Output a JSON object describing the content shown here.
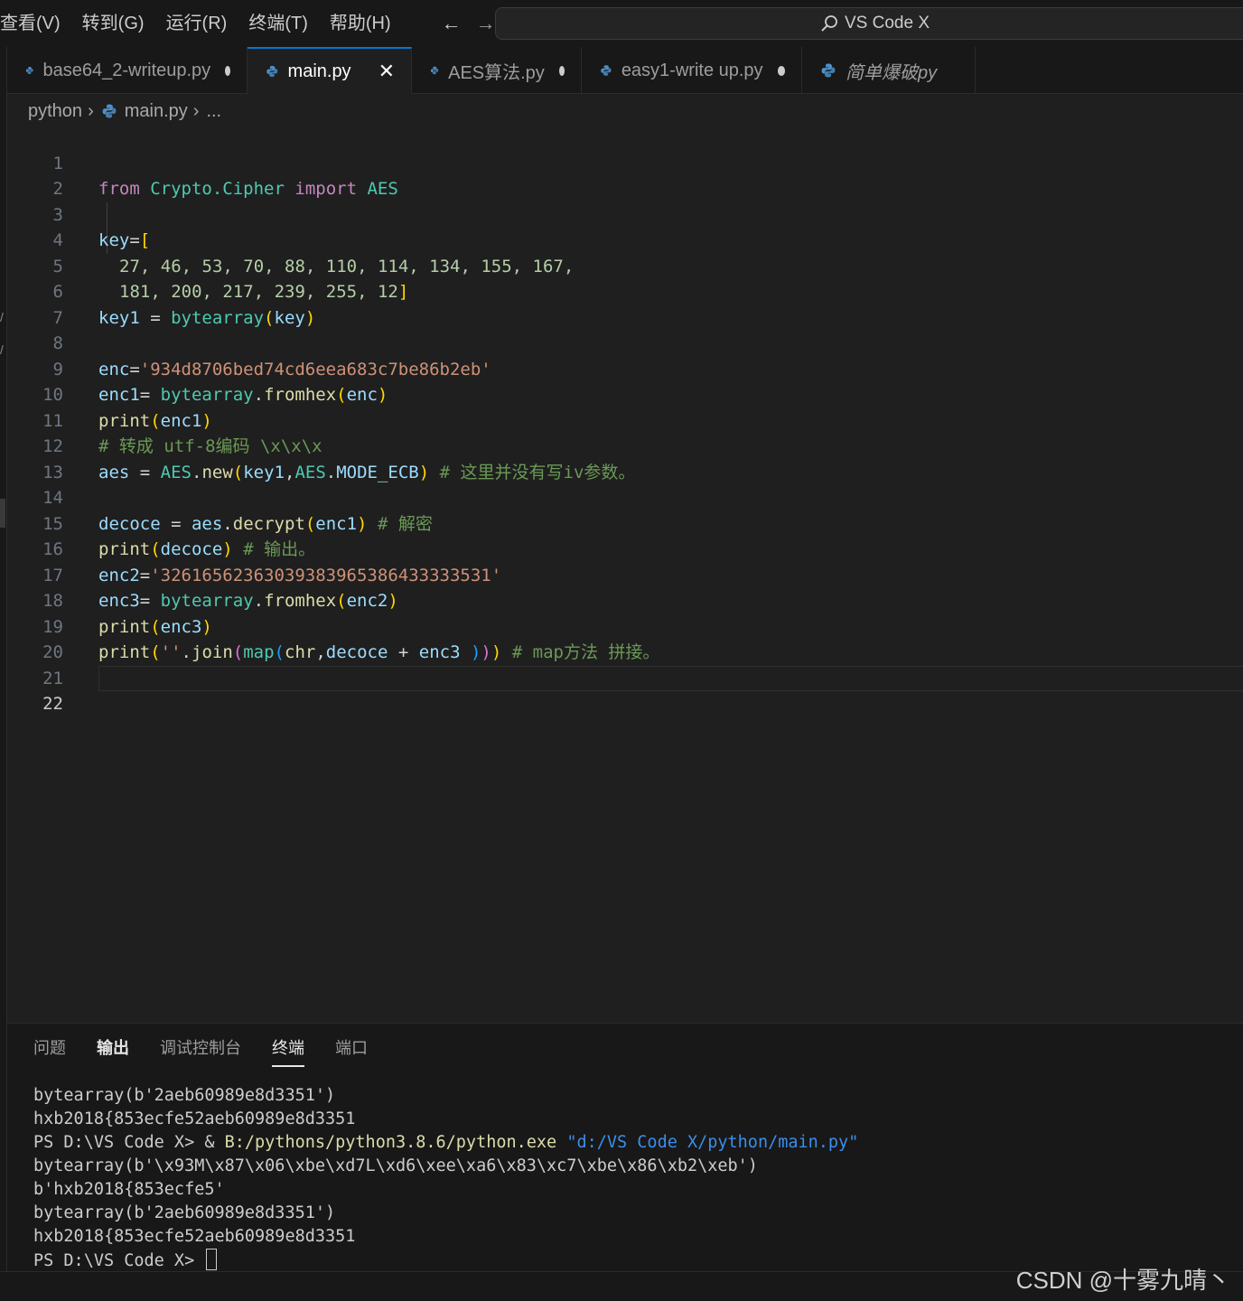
{
  "menu": [
    {
      "label": "查看(V)"
    },
    {
      "label": "转到(G)"
    },
    {
      "label": "运行(R)"
    },
    {
      "label": "终端(T)"
    },
    {
      "label": "帮助(H)"
    }
  ],
  "nav": {
    "back": "←",
    "forward": "→"
  },
  "command_center": {
    "label": "VS Code X",
    "icon": "search-icon"
  },
  "tabs": [
    {
      "label": "base64_2-writeup.py",
      "state": "modified"
    },
    {
      "label": "main.py",
      "state": "active"
    },
    {
      "label": "AES算法.py",
      "state": "modified"
    },
    {
      "label": "easy1-write up.py",
      "state": "modified"
    },
    {
      "label": "简单爆破py",
      "state": "preview"
    }
  ],
  "tab_close_glyph": "✕",
  "breadcrumb": {
    "folder": "python",
    "file": "main.py",
    "more": "..."
  },
  "editor": {
    "current_line": 22,
    "lines": [
      {
        "n": "1"
      },
      {
        "n": "2"
      },
      {
        "n": "3"
      },
      {
        "n": "4"
      },
      {
        "n": "5"
      },
      {
        "n": "6"
      },
      {
        "n": "7"
      },
      {
        "n": "8"
      },
      {
        "n": "9"
      },
      {
        "n": "10"
      },
      {
        "n": "11"
      },
      {
        "n": "12"
      },
      {
        "n": "13"
      },
      {
        "n": "14"
      },
      {
        "n": "15"
      },
      {
        "n": "16"
      },
      {
        "n": "17"
      },
      {
        "n": "18"
      },
      {
        "n": "19"
      },
      {
        "n": "20"
      },
      {
        "n": "21"
      },
      {
        "n": "22"
      }
    ],
    "code": {
      "l1": {
        "kw_from": "from",
        "module": "Crypto.Cipher",
        "kw_import": "import",
        "name": "AES"
      },
      "l3": {
        "var": "key",
        "eq": "=",
        "open": "["
      },
      "l4": {
        "nums": "27, 46, 53, 70, 88, 110, 114, 134, 155, 167,"
      },
      "l5": {
        "nums": "181, 200, 217, 239, 255, 12",
        "close": "]"
      },
      "l6": {
        "var": "key1",
        "eq": " = ",
        "fn": "bytearray",
        "open": "(",
        "arg": "key",
        "close": ")"
      },
      "l8": {
        "var": "enc",
        "eq": "=",
        "str": "'934d8706bed74cd6eea683c7be86b2eb'"
      },
      "l9": {
        "var": "enc1",
        "eq": "= ",
        "cls": "bytearray",
        "dot": ".",
        "fn": "fromhex",
        "open": "(",
        "arg": "enc",
        "close": ")"
      },
      "l10": {
        "fn": "print",
        "open": "(",
        "arg": "enc1",
        "close": ")"
      },
      "l11": {
        "comment": "# 转成 utf-8编码 \\x\\x\\x"
      },
      "l12": {
        "var": "aes",
        "eq": " = ",
        "cls": "AES",
        "dot": ".",
        "fn": "new",
        "open": "(",
        "arg1": "key1",
        "comma": ",",
        "cls2": "AES",
        "dot2": ".",
        "arg2": "MODE_ECB",
        "close": ")",
        "comment": " # 这里并没有写iv参数。"
      },
      "l14": {
        "var": "decoce",
        "eq": " = ",
        "obj": "aes",
        "dot": ".",
        "fn": "decrypt",
        "open": "(",
        "arg": "enc1",
        "close": ")",
        "comment": " # 解密"
      },
      "l15": {
        "fn": "print",
        "open": "(",
        "arg": "decoce",
        "close": ")",
        "comment": " # 输出。"
      },
      "l16": {
        "var": "enc2",
        "eq": "=",
        "str": "'32616562363039383965386433333531'"
      },
      "l17": {
        "var": "enc3",
        "eq": "= ",
        "cls": "bytearray",
        "dot": ".",
        "fn": "fromhex",
        "open": "(",
        "arg": "enc2",
        "close": ")"
      },
      "l18": {
        "fn": "print",
        "open": "(",
        "arg": "enc3",
        "close": ")"
      },
      "l19": {
        "fn": "print",
        "open": "(",
        "str": "''",
        "dot": ".",
        "fn2": "join",
        "open2": "(",
        "fn3": "map",
        "open3": "(",
        "arg1": "chr",
        "comma": ",",
        "arg2": "decoce",
        "plus": " + ",
        "arg3": "enc3",
        "closes3": " )",
        "closes2": ")",
        "closes1": ")",
        "comment": " # map方法 拼接。"
      }
    }
  },
  "panel": {
    "tabs": [
      {
        "label": "问题"
      },
      {
        "label": "输出"
      },
      {
        "label": "调试控制台"
      },
      {
        "label": "终端"
      },
      {
        "label": "端口"
      }
    ],
    "terminal": {
      "l1": "bytearray(b'2aeb60989e8d3351')",
      "l2": "hxb2018{853ecfe52aeb60989e8d3351",
      "l3_prompt": "PS D:\\VS Code X> & ",
      "l3_exe": "B:/pythons/python3.8.6/python.exe",
      "l3_arg": " \"d:/VS Code X/python/main.py\"",
      "l4": "bytearray(b'\\x93M\\x87\\x06\\xbe\\xd7L\\xd6\\xee\\xa6\\x83\\xc7\\xbe\\x86\\xb2\\xeb')",
      "l5": "b'hxb2018{853ecfe5'",
      "l6": "bytearray(b'2aeb60989e8d3351')",
      "l7": "hxb2018{853ecfe52aeb60989e8d3351",
      "l8": "PS D:\\VS Code X> "
    }
  },
  "watermark": "CSDN @十雾九晴丶",
  "colors": {
    "keyword": "#c586c0",
    "class": "#4ec9b0",
    "variable": "#9cdcfe",
    "function": "#dcdcaa",
    "string": "#ce9178",
    "comment": "#6a9955",
    "accent": "#0078d4"
  }
}
